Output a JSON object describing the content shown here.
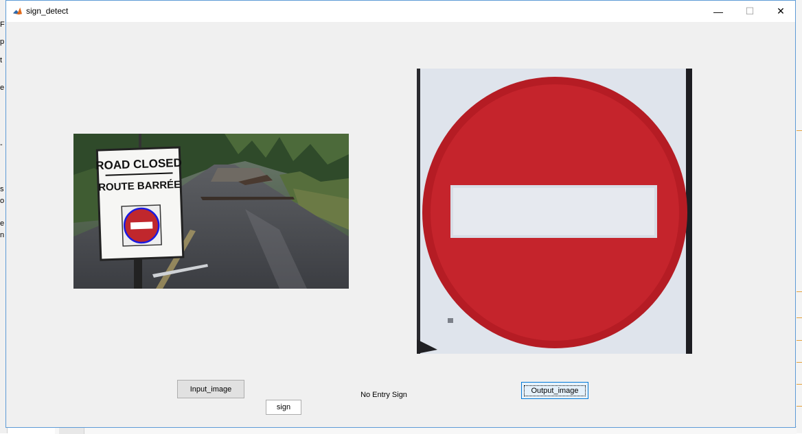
{
  "window": {
    "title": "sign_detect",
    "minimize_glyph": "—",
    "maximize_glyph": "☐",
    "close_glyph": "✕"
  },
  "input_image": {
    "sign_line1": "ROAD CLOSED",
    "sign_line2": "ROUTE BARRÉE"
  },
  "buttons": {
    "input_label": "Input_image",
    "sign_label": "sign",
    "output_label": "Output_image"
  },
  "result": {
    "text": "No Entry Sign"
  },
  "colors": {
    "window_bg": "#f0f0f0",
    "sign_red": "#b51c24",
    "focus_blue": "#0078d7"
  },
  "icons": {
    "app": "matlab-icon",
    "minimize": "minimize-icon",
    "maximize": "maximize-icon",
    "close": "close-icon"
  }
}
